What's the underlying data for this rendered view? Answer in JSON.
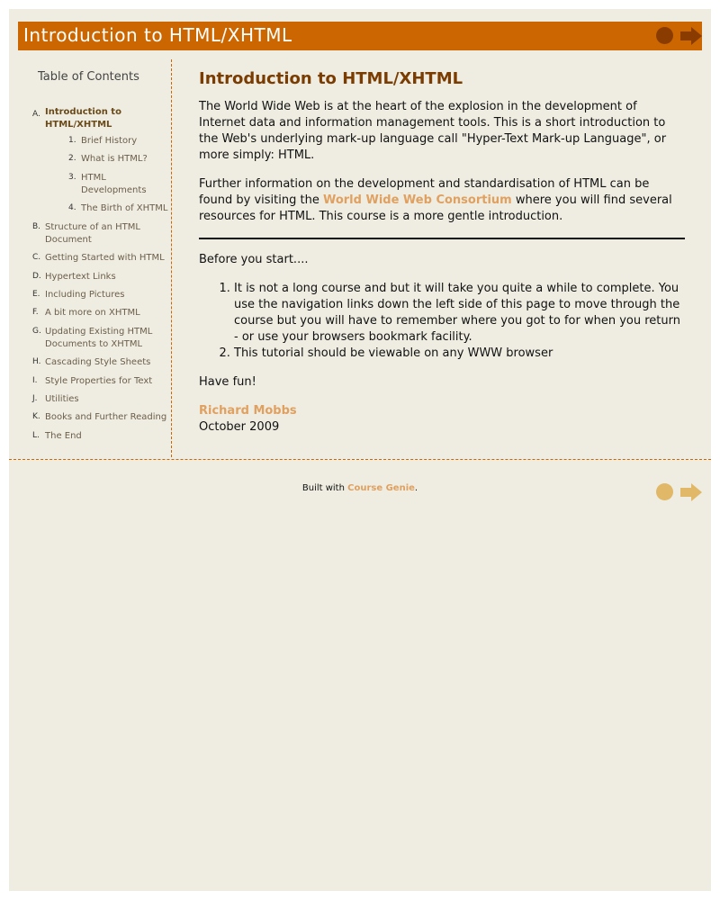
{
  "header": {
    "title": "Introduction to HTML/XHTML",
    "prev_icon": "circle-prev-icon",
    "next_icon": "arrow-next-icon",
    "color": "#cc6600"
  },
  "toc": {
    "heading": "Table of Contents",
    "items": [
      {
        "marker": "A.",
        "label": "Introduction to HTML/XHTML",
        "current": true,
        "children": [
          {
            "marker": "1.",
            "label": "Brief History"
          },
          {
            "marker": "2.",
            "label": "What is HTML?"
          },
          {
            "marker": "3.",
            "label": "HTML Developments"
          },
          {
            "marker": "4.",
            "label": "The Birth of XHTML"
          }
        ]
      },
      {
        "marker": "B.",
        "label": "Structure of an HTML Document"
      },
      {
        "marker": "C.",
        "label": "Getting Started with HTML"
      },
      {
        "marker": "D.",
        "label": "Hypertext Links"
      },
      {
        "marker": "E.",
        "label": "Including Pictures"
      },
      {
        "marker": "F.",
        "label": "A bit more on XHTML"
      },
      {
        "marker": "G.",
        "label": "Updating Existing HTML Documents to XHTML"
      },
      {
        "marker": "H.",
        "label": "Cascading Style Sheets"
      },
      {
        "marker": "I.",
        "label": "Style Properties for Text"
      },
      {
        "marker": "J.",
        "label": "Utilities"
      },
      {
        "marker": "K.",
        "label": "Books and Further Reading"
      },
      {
        "marker": "L.",
        "label": "The End"
      }
    ]
  },
  "main": {
    "heading": "Introduction to HTML/XHTML",
    "para1": "The World Wide Web is at the heart of the explosion in the development of Internet data and information management tools. This is a short introduction to the Web's underlying mark-up language call \"Hyper-Text Mark-up Language\", or more simply: HTML.",
    "para2_before": "Further information on the development and standardisation of HTML can be found by visiting the ",
    "para2_link": "World Wide Web Consortium",
    "para2_after": " where you will find several resources for HTML. This course is a more gentle introduction.",
    "before_start": "Before you start....",
    "list": [
      "It is not a long course and but it will take you quite a while to complete. You use the navigation links down the left side of this page to move through the course but you will have to remember where you got to for when you return - or use your browsers bookmark facility.",
      "This tutorial should be viewable on any WWW browser"
    ],
    "have_fun": "Have fun!",
    "author": "Richard Mobbs",
    "date": "October 2009"
  },
  "footer": {
    "built_with": "Built with ",
    "link": "Course Genie",
    "period": ".",
    "prev_icon": "circle-prev-icon",
    "next_icon": "arrow-next-icon",
    "color": "#e0b868"
  }
}
